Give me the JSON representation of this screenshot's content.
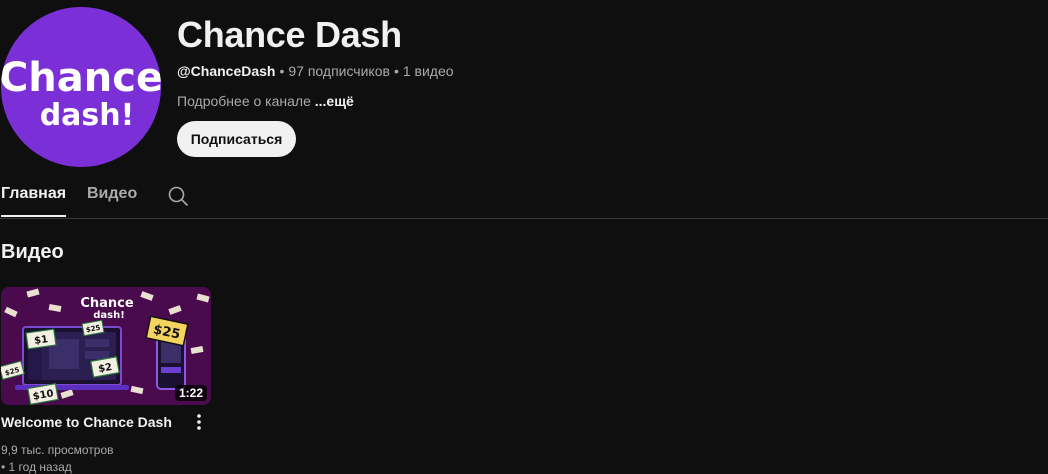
{
  "channel": {
    "avatar_text_line1": "Chance",
    "avatar_text_line2": "dash!",
    "avatar_color": "#7b2fd6",
    "name": "Chance Dash",
    "handle": "@ChanceDash",
    "subscribers": "97 подписчиков",
    "videos_count": "1 видео",
    "separator": "•",
    "about_label": "Подробнее о канале",
    "about_more": "...ещё",
    "subscribe_label": "Подписаться"
  },
  "tabs": [
    {
      "label": "Главная",
      "active": true
    },
    {
      "label": "Видео",
      "active": false
    }
  ],
  "icons": {
    "search": "search-icon",
    "more": "more-vert-icon"
  },
  "section": {
    "title": "Видео"
  },
  "videos": [
    {
      "title": "Welcome to Chance Dash",
      "duration": "1:22",
      "views": "9,9 тыс. просмотров",
      "age": "• 1 год назад",
      "thumbnail": {
        "logo_line1": "Chance",
        "logo_line2": "dash!",
        "badges": [
          "$1",
          "$25",
          "$25",
          "$2",
          "$25",
          "$10"
        ],
        "background": "#4a0a4e"
      }
    }
  ]
}
